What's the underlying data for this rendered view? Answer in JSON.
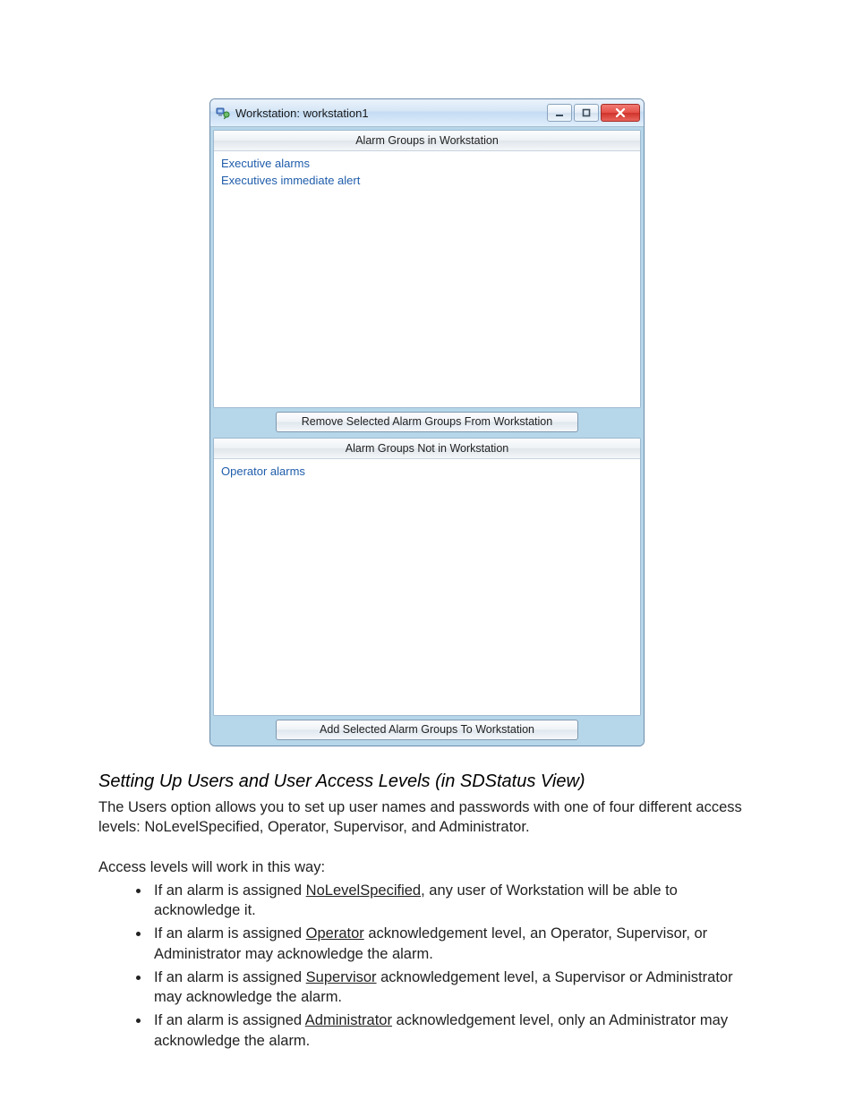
{
  "window": {
    "title": "Workstation: workstation1",
    "icon_name": "workstation-icon",
    "buttons": {
      "min": "minimize",
      "max": "maximize",
      "close": "close"
    },
    "top_panel": {
      "header": "Alarm Groups in Workstation",
      "items": [
        "Executive alarms",
        "Executives immediate alert"
      ],
      "action_button": "Remove Selected Alarm Groups From Workstation"
    },
    "bottom_panel": {
      "header": "Alarm Groups Not in Workstation",
      "items": [
        "Operator alarms"
      ],
      "action_button": "Add Selected Alarm Groups To Workstation"
    }
  },
  "doc": {
    "heading": "Setting Up Users and User Access Levels (in SDStatus View)",
    "intro_sentence_lead": "The Users option allows you to set up user names and passwords with one of four different access levels: ",
    "intro_levels": [
      "NoLevelSpecified",
      "Operator",
      "Supervisor",
      "Administrator"
    ],
    "intro_tail": ".",
    "access_line": "Access levels will work in this way:",
    "bullets": [
      {
        "pre": "If an alarm is assigned ",
        "u": "NoLevelSpecified",
        "post": ", any user of Workstation will be able to acknowledge it."
      },
      {
        "pre": "If an alarm is assigned ",
        "u": "Operator",
        "post": " acknowledgement level, an Operator, Supervisor, or Administrator may acknowledge the alarm."
      },
      {
        "pre": "If an alarm is assigned ",
        "u": "Supervisor",
        "post": " acknowledgement level, a Supervisor or Administrator may acknowledge the alarm."
      },
      {
        "pre": "If an alarm is assigned ",
        "u": "Administrator",
        "post": " acknowledgement level, only an Administrator may acknowledge the alarm."
      }
    ]
  }
}
